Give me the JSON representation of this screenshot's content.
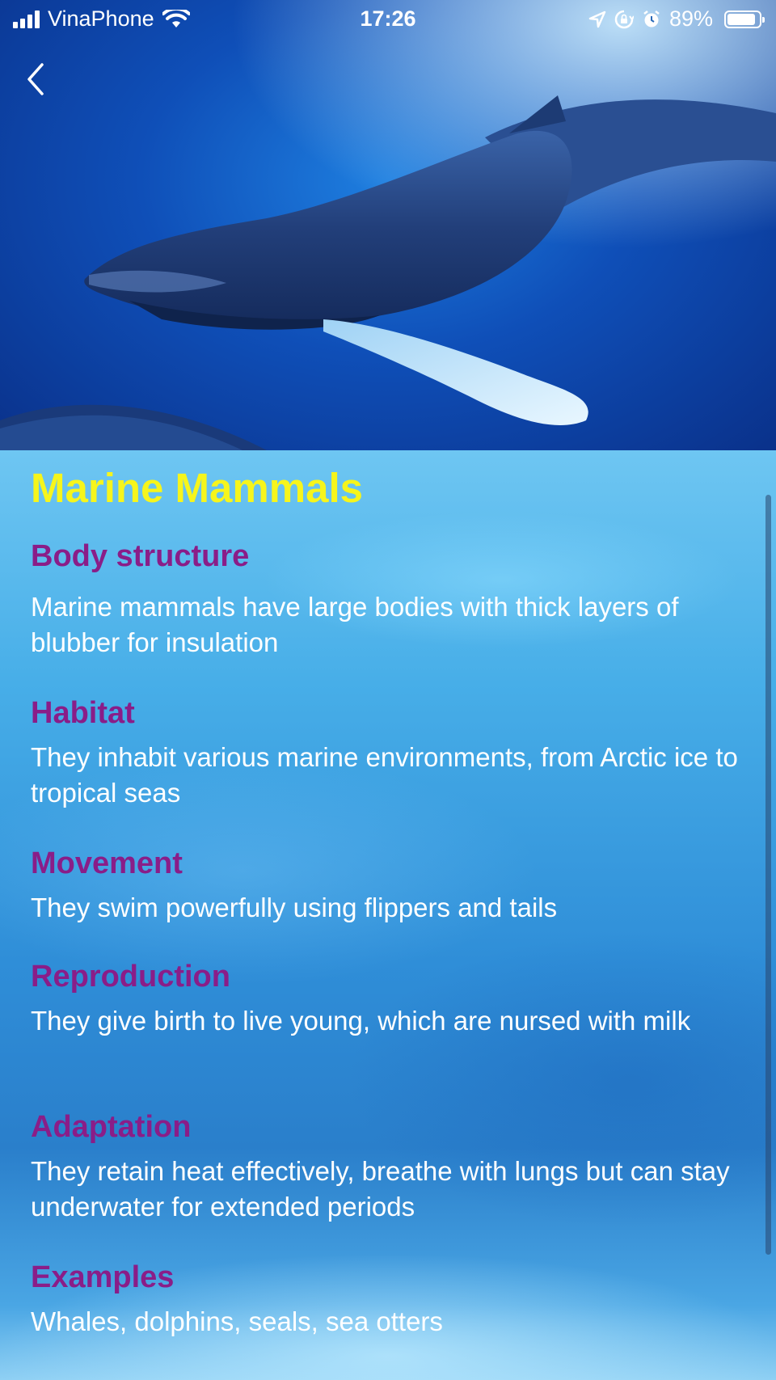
{
  "status_bar": {
    "carrier": "VinaPhone",
    "time": "17:26",
    "battery": "89%",
    "battery_level": 0.89,
    "icons": [
      "signal-icon",
      "wifi-icon",
      "location-arrow-icon",
      "orientation-lock-icon",
      "alarm-icon",
      "battery-icon"
    ]
  },
  "nav": {
    "back_icon": "chevron-left-icon"
  },
  "hero": {
    "image": "humpback-whale-underwater-photo"
  },
  "page": {
    "title": "Marine Mammals"
  },
  "sections": [
    {
      "heading": "Body structure",
      "body": "Marine mammals have large bodies with thick layers of blubber for insulation"
    },
    {
      "heading": "Habitat",
      "body": "They inhabit various marine environments, from Arctic ice to tropical seas"
    },
    {
      "heading": "Movement",
      "body": "They swim powerfully using flippers and tails"
    },
    {
      "heading": "Reproduction",
      "body": "They give birth to live young, which are nursed with milk"
    },
    {
      "heading": "Adaptation",
      "body": "They retain heat effectively, breathe with lungs but can stay underwater for extended periods"
    },
    {
      "heading": "Examples",
      "body": "Whales, dolphins, seals, sea otters"
    }
  ],
  "colors": {
    "title": "#f6f51c",
    "heading": "#8a1d88",
    "body_text": "#ffffff"
  }
}
